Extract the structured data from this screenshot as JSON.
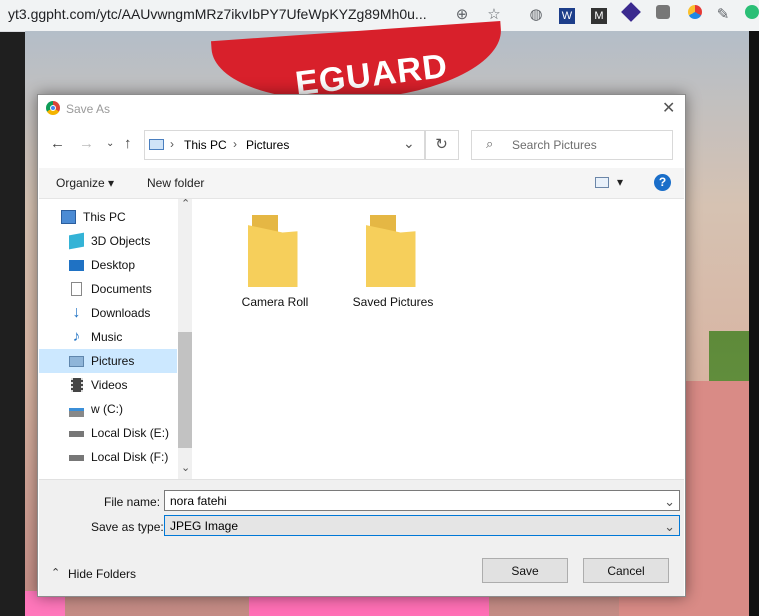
{
  "browser": {
    "url": "yt3.ggpht.com/ytc/AAUvwngmMRz7ikvIbPY7UfeWpKYZg89Mh0u...",
    "icons": [
      "zoom-icon",
      "bookmark-star-icon",
      "globe-extension-icon",
      "wave-extension-icon",
      "mendeley-extension-icon",
      "purple-extension-icon",
      "image-extension-icon",
      "colorful-extension-icon",
      "eyedropper-extension-icon",
      "green-extension-icon"
    ]
  },
  "background": {
    "cap_text": "EGUARD"
  },
  "dialog": {
    "title": "Save As",
    "close_glyph": "✕",
    "breadcrumb": [
      "This PC",
      "Pictures"
    ],
    "search_placeholder": "Search Pictures",
    "toolbar": {
      "organize": "Organize",
      "new_folder": "New folder",
      "help": "?"
    },
    "nav_items": [
      {
        "label": "This PC",
        "icon": "computer-icon"
      },
      {
        "label": "3D Objects",
        "icon": "cube-icon"
      },
      {
        "label": "Desktop",
        "icon": "desktop-icon"
      },
      {
        "label": "Documents",
        "icon": "document-icon"
      },
      {
        "label": "Downloads",
        "icon": "download-arrow-icon"
      },
      {
        "label": "Music",
        "icon": "music-note-icon"
      },
      {
        "label": "Pictures",
        "icon": "pictures-icon",
        "selected": true
      },
      {
        "label": "Videos",
        "icon": "film-icon"
      },
      {
        "label": "w (C:)",
        "icon": "drive-icon"
      },
      {
        "label": "Local Disk (E:)",
        "icon": "disk-icon"
      },
      {
        "label": "Local Disk (F:)",
        "icon": "disk-icon"
      }
    ],
    "folders": [
      "Camera Roll",
      "Saved Pictures"
    ],
    "file_name_label": "File name:",
    "file_name_value": "nora fatehi",
    "save_type_label": "Save as type:",
    "save_type_value": "JPEG Image",
    "hide_folders": "Hide Folders",
    "save_button": "Save",
    "cancel_button": "Cancel"
  },
  "colors": {
    "accent": "#1a6ec9",
    "selected_row": "#cce8ff",
    "folder_yellow": "#f6cf5b"
  }
}
